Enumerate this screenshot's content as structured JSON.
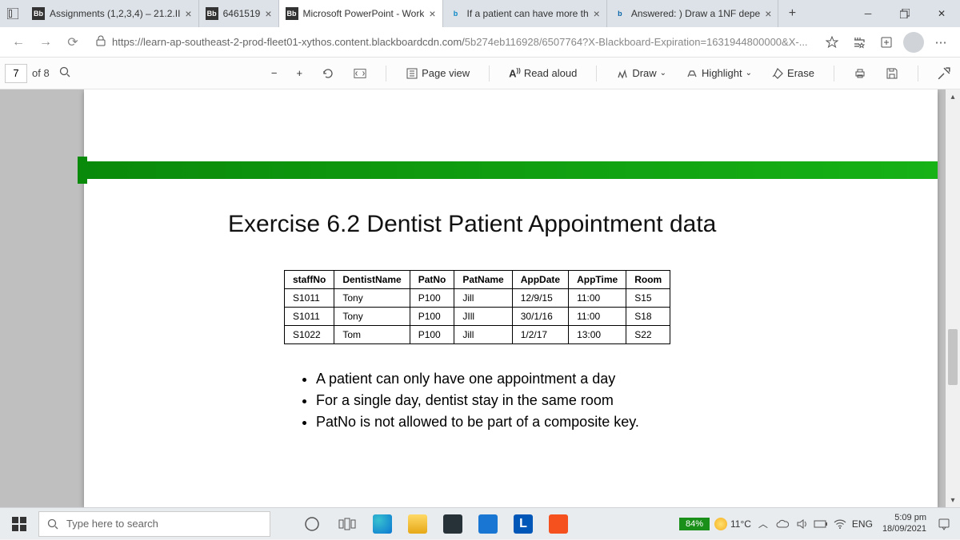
{
  "tabs": [
    {
      "icon": "Bb",
      "title": "Assignments (1,2,3,4) – 21.2.II"
    },
    {
      "icon": "Bb",
      "title": "6461519"
    },
    {
      "icon": "Bb",
      "title": "Microsoft PowerPoint - Work"
    },
    {
      "icon": "b",
      "title": "If a patient can have more th"
    },
    {
      "icon": "b",
      "title": "Answered: ) Draw a 1NF depe"
    }
  ],
  "url": {
    "host": "https://learn-ap-southeast-2-prod-fleet01-xythos.content.blackboardcdn.com/",
    "path": "5b274eb116928/6507764?X-Blackboard-Expiration=1631944800000&X-..."
  },
  "pdf": {
    "current_page": "7",
    "page_total": "of 8",
    "page_view": "Page view",
    "read_aloud": "Read aloud",
    "draw": "Draw",
    "highlight": "Highlight",
    "erase": "Erase"
  },
  "slide": {
    "title": "Exercise 6.2 Dentist Patient Appointment data",
    "headers": [
      "staffNo",
      "DentistName",
      "PatNo",
      "PatName",
      "AppDate",
      "AppTime",
      "Room"
    ],
    "rows": [
      [
        "S1011",
        "Tony",
        "P100",
        "Jill",
        "12/9/15",
        "11:00",
        "S15"
      ],
      [
        "S1011",
        "Tony",
        "P100",
        "JIll",
        "30/1/16",
        "11:00",
        "S18"
      ],
      [
        "S1022",
        "Tom",
        "P100",
        "Jill",
        "1/2/17",
        "13:00",
        "S22"
      ]
    ],
    "bullets": [
      "A patient can only have one appointment a day",
      "For a single day, dentist stay in the same room",
      "PatNo is not allowed to be part of a composite key."
    ]
  },
  "taskbar": {
    "search_placeholder": "Type here to search",
    "battery": "84%",
    "temp": "11°C",
    "lang": "ENG",
    "time": "5:09 pm",
    "date": "18/09/2021"
  }
}
